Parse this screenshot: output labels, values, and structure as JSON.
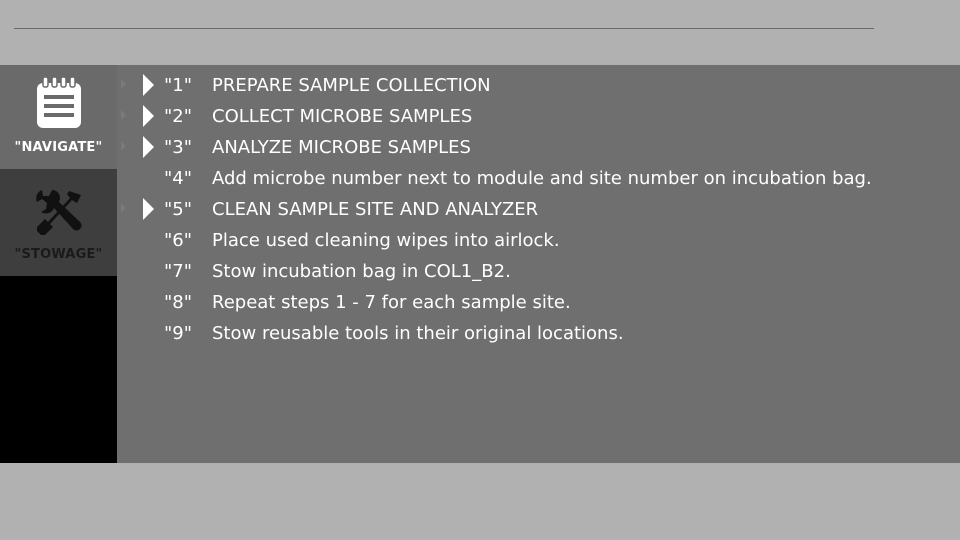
{
  "sidebar": {
    "navigate": {
      "label": "\"NAVIGATE\"",
      "icon": "notepad-icon"
    },
    "stowage": {
      "label": "\"STOWAGE\"",
      "icon": "tools-icon"
    }
  },
  "steps": [
    {
      "num": "\"1\"",
      "text": "PREPARE SAMPLE COLLECTION",
      "expandable": true
    },
    {
      "num": "\"2\"",
      "text": "COLLECT MICROBE SAMPLES",
      "expandable": true
    },
    {
      "num": "\"3\"",
      "text": "ANALYZE MICROBE SAMPLES",
      "expandable": true
    },
    {
      "num": "\"4\"",
      "text": "Add microbe number next to module and site number on incubation bag.",
      "expandable": false
    },
    {
      "num": "\"5\"",
      "text": "CLEAN SAMPLE SITE AND ANALYZER",
      "expandable": true
    },
    {
      "num": "\"6\"",
      "text": "Place used cleaning wipes into airlock.",
      "expandable": false
    },
    {
      "num": "\"7\"",
      "text": "Stow incubation bag in COL1_B2.",
      "expandable": false
    },
    {
      "num": "\"8\"",
      "text": "Repeat steps 1 - 7 for each sample site.",
      "expandable": false
    },
    {
      "num": "\"9\"",
      "text": "Stow reusable tools in their original locations.",
      "expandable": false
    }
  ],
  "colors": {
    "background": "#b1b1b1",
    "panel": "#6f6f6f",
    "nav_active": "#6a6a6a",
    "nav_inactive": "#3e3e3e",
    "text": "#ffffff"
  }
}
